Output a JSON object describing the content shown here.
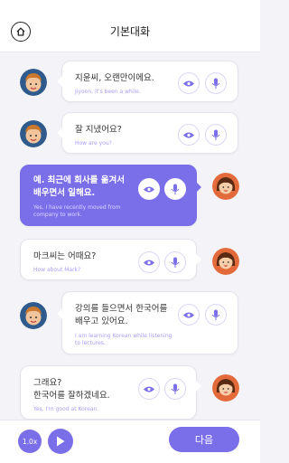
{
  "header": {
    "title": "기본대화",
    "home_icon": "home-icon"
  },
  "messages": [
    {
      "speaker": "boy",
      "ko": "지윤씨, 오랜만이에요.",
      "en": "Jiyoon, it's been a while."
    },
    {
      "speaker": "boy",
      "ko": "잘 지냈어요?",
      "en": "How are you?"
    },
    {
      "speaker": "girl",
      "ko": "예. 최근에 회사를 옮겨서\n배우면서 일해요.",
      "en": "Yes, I have recently moved from\ncompany to work."
    },
    {
      "speaker": "girl",
      "ko": "마크씨는 어때요?",
      "en": "How about Mark?"
    },
    {
      "speaker": "boy",
      "ko": "강의를 들으면서 한국어를\n배우고 있어요.",
      "en": "I am learning Korean while listening\nto lectures."
    },
    {
      "speaker": "girl",
      "ko": "그래요?\n한국어를 잘하겠네요.",
      "en": "Yes, I'm good at Korean."
    }
  ],
  "footer": {
    "speed_label": "1.0x",
    "next_label": "다음"
  },
  "colors": {
    "accent": "#7b6ee9",
    "background": "#f3f3f8"
  }
}
